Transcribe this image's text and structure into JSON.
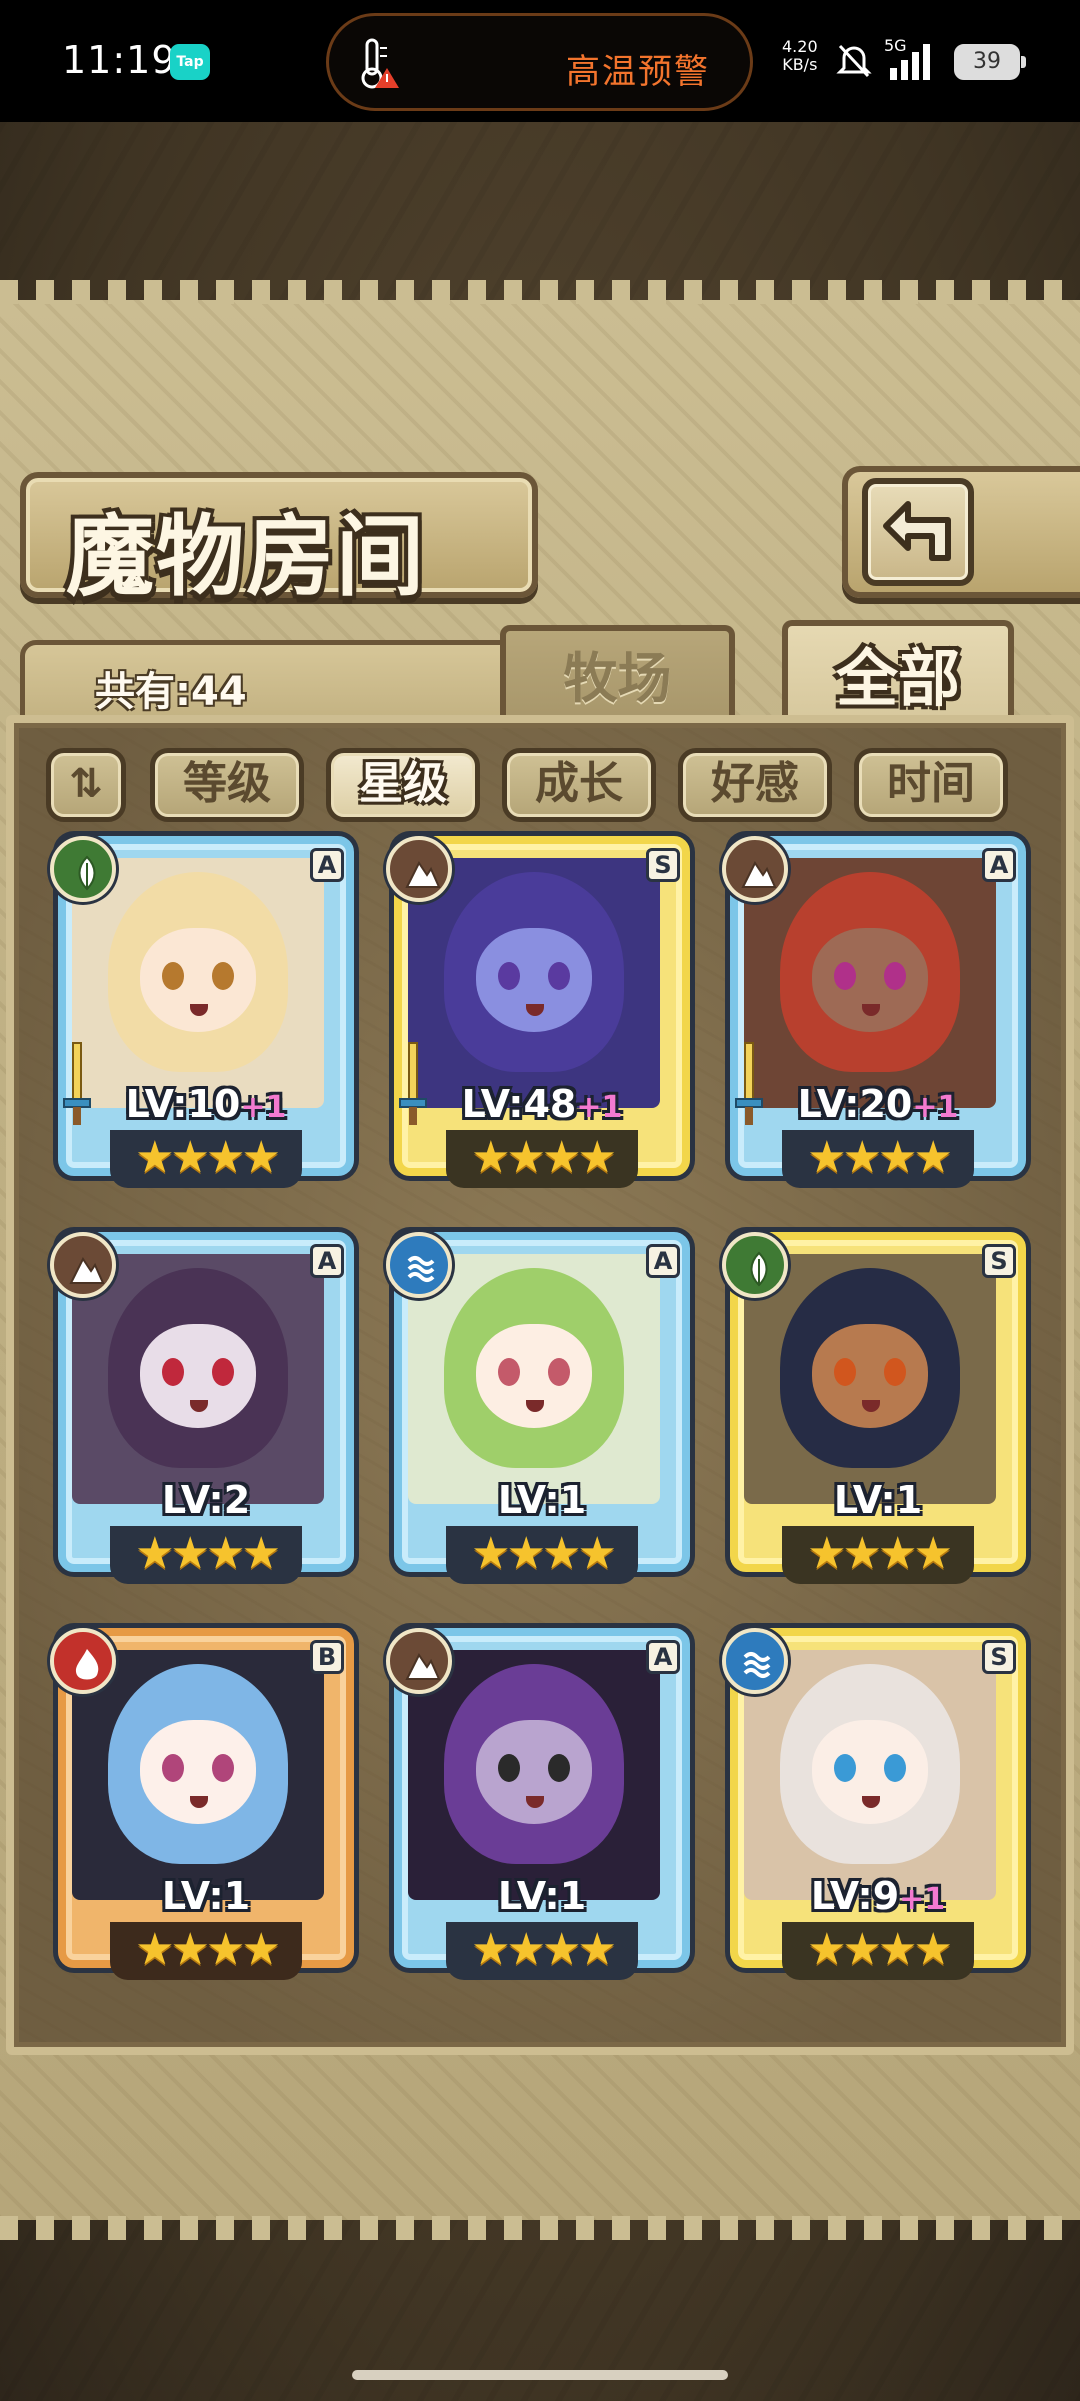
{
  "status_bar": {
    "time": "11:19",
    "tap_label": "Tap",
    "alert": "高温预警",
    "speed_value": "4.20",
    "speed_unit": "KB/s",
    "network": "5G",
    "battery": "39"
  },
  "header": {
    "title": "魔物房间"
  },
  "summary": {
    "count_label": "共有:44"
  },
  "tabs": [
    {
      "label": "牧场",
      "active": false
    },
    {
      "label": "全部",
      "active": true
    }
  ],
  "filters": {
    "sort_toggle": "⇅",
    "items": [
      {
        "label": "等级",
        "active": false
      },
      {
        "label": "星级",
        "active": true
      },
      {
        "label": "成长",
        "active": false
      },
      {
        "label": "好感",
        "active": false
      },
      {
        "label": "时间",
        "active": false
      }
    ]
  },
  "monsters": [
    {
      "element": "nature",
      "rank": "A",
      "frame": "blue",
      "level": "LV:10",
      "bonus": "+1",
      "stars": "★★★★",
      "equipped": true,
      "hair": "#f2dca6",
      "skin": "#fbe7d4",
      "eye": "#b6792e",
      "bg": "#e9dcc0"
    },
    {
      "element": "earth",
      "rank": "S",
      "frame": "gold",
      "level": "LV:48",
      "bonus": "+1",
      "stars": "★★★★",
      "equipped": true,
      "hair": "#4a3c9a",
      "skin": "#8a8fe0",
      "eye": "#5a3aa0",
      "bg": "#3d3580"
    },
    {
      "element": "earth",
      "rank": "A",
      "frame": "blue",
      "level": "LV:20",
      "bonus": "+1",
      "stars": "★★★★",
      "equipped": true,
      "hair": "#b8402e",
      "skin": "#9e6a55",
      "eye": "#b0308a",
      "bg": "#6e4535"
    },
    {
      "element": "earth",
      "rank": "A",
      "frame": "blue",
      "level": "LV:2",
      "bonus": "",
      "stars": "★★★★",
      "equipped": false,
      "hair": "#4a3355",
      "skin": "#e8dde8",
      "eye": "#c0283c",
      "bg": "#5a4a66"
    },
    {
      "element": "water",
      "rank": "A",
      "frame": "blue",
      "level": "LV:1",
      "bonus": "",
      "stars": "★★★★",
      "equipped": false,
      "hair": "#9fcf6a",
      "skin": "#fdeee3",
      "eye": "#c45a6a",
      "bg": "#dfe9d0"
    },
    {
      "element": "nature",
      "rank": "S",
      "frame": "gold",
      "level": "LV:1",
      "bonus": "",
      "stars": "★★★★",
      "equipped": false,
      "hair": "#262c45",
      "skin": "#b77a4f",
      "eye": "#d1561e",
      "bg": "#7a6a4a"
    },
    {
      "element": "fire",
      "rank": "B",
      "frame": "orange",
      "level": "LV:1",
      "bonus": "",
      "stars": "★★★★",
      "equipped": false,
      "hair": "#7fb6e6",
      "skin": "#fdf0ea",
      "eye": "#b0457a",
      "bg": "#2a2a3a"
    },
    {
      "element": "earth",
      "rank": "A",
      "frame": "blue",
      "level": "LV:1",
      "bonus": "",
      "stars": "★★★★",
      "equipped": false,
      "hair": "#6a3d96",
      "skin": "#b9a4cf",
      "eye": "#2a2a2a",
      "bg": "#2a2038"
    },
    {
      "element": "water",
      "rank": "S",
      "frame": "gold",
      "level": "LV:9",
      "bonus": "+1",
      "stars": "★★★★",
      "equipped": false,
      "hair": "#e9e2dd",
      "skin": "#fbeee6",
      "eye": "#3a9ad6",
      "bg": "#d9c3a8"
    }
  ]
}
